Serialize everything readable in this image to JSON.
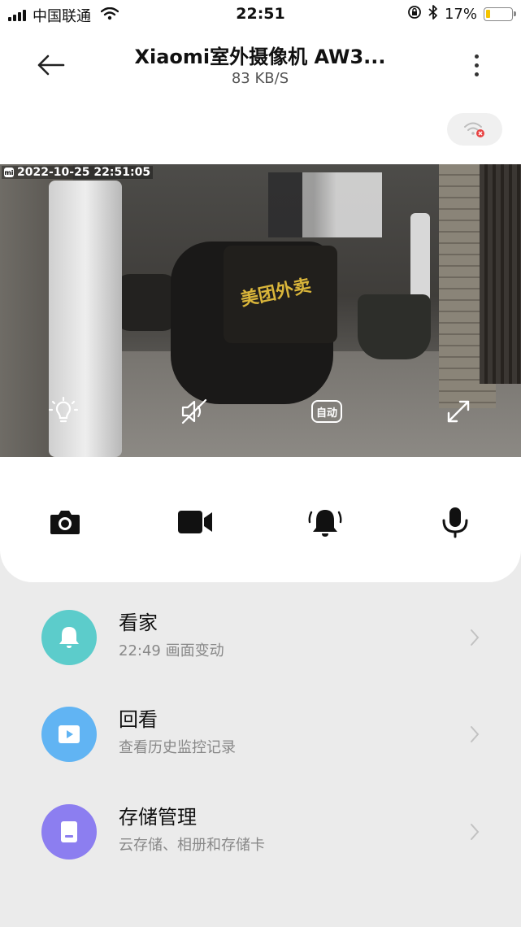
{
  "status_bar": {
    "carrier": "中国联通",
    "time": "22:51",
    "battery_percent": "17%",
    "battery_level": 0.17,
    "icons": [
      "signal-icon",
      "wifi-icon",
      "orientation-lock-icon",
      "bluetooth-icon",
      "battery-icon"
    ]
  },
  "header": {
    "title": "Xiaomi室外摄像机 AW3...",
    "subtitle": "83 KB/S",
    "back_icon": "arrow-left-icon",
    "more_icon": "more-vertical-icon",
    "network_icon": "wifi-error-icon"
  },
  "video": {
    "timestamp": "2022-10-25 22:51:05",
    "box_text": "美团外卖",
    "auto_label": "自动",
    "controls": [
      "lightbulb-icon",
      "mute-icon",
      "auto-mode-icon",
      "fullscreen-icon"
    ]
  },
  "actions": [
    "camera-icon",
    "video-record-icon",
    "alarm-bell-icon",
    "microphone-icon"
  ],
  "list": [
    {
      "title": "看家",
      "subtitle": "22:49 画面变动",
      "icon": "bell-icon",
      "color": "#5ccccb"
    },
    {
      "title": "回看",
      "subtitle": "查看历史监控记录",
      "icon": "play-icon",
      "color": "#61b4f3"
    },
    {
      "title": "存储管理",
      "subtitle": "云存储、相册和存储卡",
      "icon": "storage-icon",
      "color": "#8c7ef0"
    }
  ],
  "colors": {
    "background": "#ebebeb",
    "card": "#ffffff",
    "battery": "#f5c400",
    "error_badge": "#e84343"
  }
}
